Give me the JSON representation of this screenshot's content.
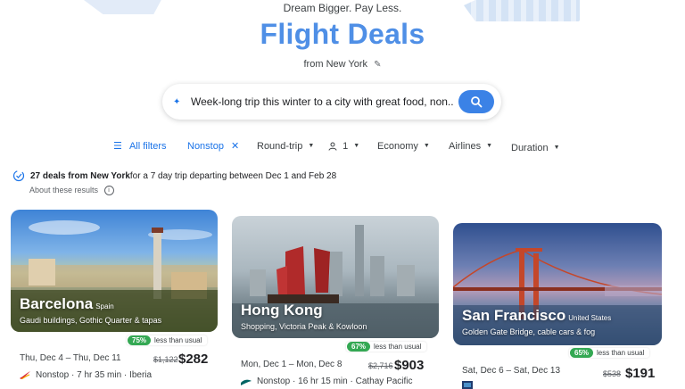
{
  "header": {
    "tagline": "Dream Bigger. Pay Less.",
    "title": "Flight Deals",
    "from_label": "from",
    "from_city": "New York"
  },
  "search": {
    "query": "Week-long trip this winter to a city with great food, non.."
  },
  "filters": {
    "all_filters": "All filters",
    "nonstop": "Nonstop",
    "trip_type": "Round-trip",
    "passengers": "1",
    "cabin": "Economy",
    "airlines": "Airlines",
    "duration": "Duration"
  },
  "summary": {
    "count_text": "27 deals from New York",
    "rest_text": " for a 7 day trip departing between Dec 1 and Feb 28",
    "about": "About these results"
  },
  "colors": {
    "accent": "#1a73e8",
    "title": "#4f8fe6",
    "badge_green": "#34a853"
  },
  "deals": [
    {
      "city": "Barcelona",
      "country": "Spain",
      "description": "Gaudi buildings, Gothic Quarter & tapas",
      "badge_pct": "75%",
      "badge_text": "less than usual",
      "dates": "Thu, Dec 4 – Thu, Dec 11",
      "old_price": "$1,122",
      "price": "$282",
      "route": "Nonstop · 7 hr 35 min · Iberia"
    },
    {
      "city": "Hong Kong",
      "country": "",
      "description": "Shopping, Victoria Peak & Kowloon",
      "badge_pct": "67%",
      "badge_text": "less than usual",
      "dates": "Mon, Dec 1 – Mon, Dec 8",
      "old_price": "$2,716",
      "price": "$903",
      "route": "Nonstop · 16 hr 15 min · Cathay Pacific"
    },
    {
      "city": "San Francisco",
      "country": "United States",
      "description": "Golden Gate Bridge, cable cars & fog",
      "badge_pct": "65%",
      "badge_text": "less than usual",
      "dates": "Sat, Dec 6 – Sat, Dec 13",
      "old_price": "$538",
      "price": "$191",
      "route": ""
    }
  ]
}
